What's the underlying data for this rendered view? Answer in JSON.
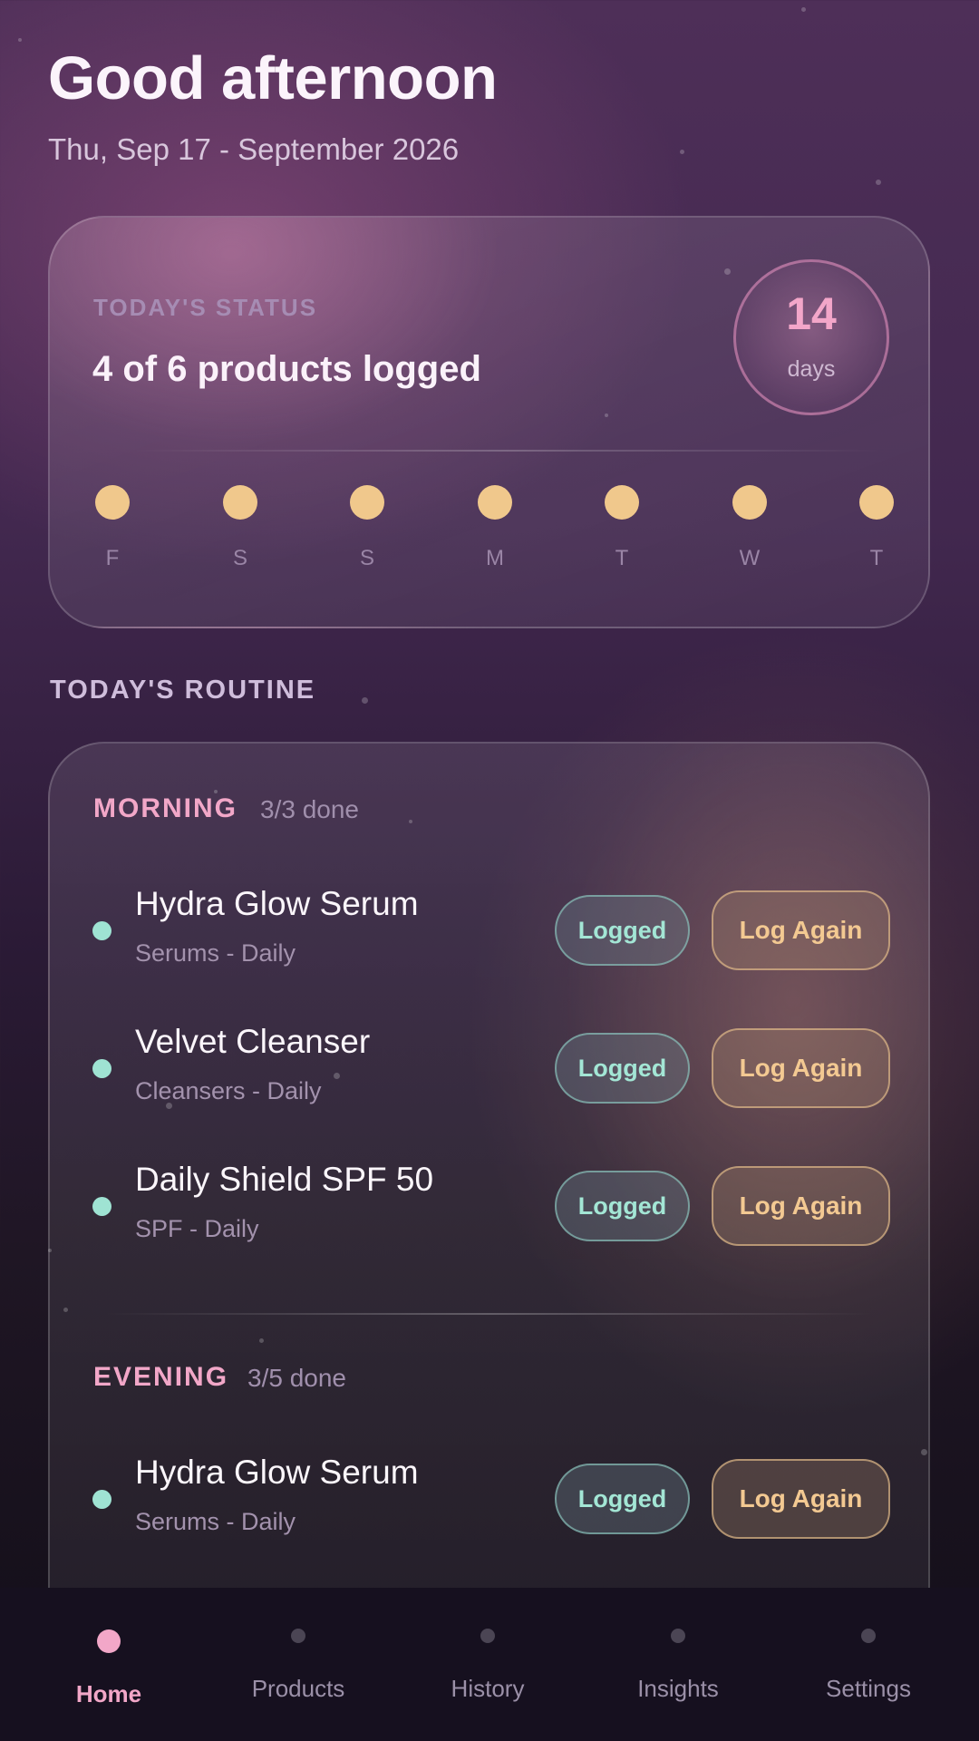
{
  "header": {
    "greeting": "Good afternoon",
    "date": "Thu, Sep 17 - September 2026"
  },
  "status": {
    "label": "TODAY'S STATUS",
    "summary": "4 of 6 products logged",
    "streak_number": "14",
    "streak_unit": "days",
    "week": [
      {
        "label": "F",
        "completed": true
      },
      {
        "label": "S",
        "completed": true
      },
      {
        "label": "S",
        "completed": true
      },
      {
        "label": "M",
        "completed": true
      },
      {
        "label": "T",
        "completed": true
      },
      {
        "label": "W",
        "completed": true
      },
      {
        "label": "T",
        "completed": true
      }
    ]
  },
  "routine": {
    "heading": "TODAY'S ROUTINE",
    "morning": {
      "title": "MORNING",
      "count": "3/3 done",
      "items": [
        {
          "name": "Hydra Glow Serum",
          "meta": "Serums - Daily",
          "logged_label": "Logged",
          "again_label": "Log Again"
        },
        {
          "name": "Velvet Cleanser",
          "meta": "Cleansers - Daily",
          "logged_label": "Logged",
          "again_label": "Log Again"
        },
        {
          "name": "Daily Shield SPF 50",
          "meta": "SPF - Daily",
          "logged_label": "Logged",
          "again_label": "Log Again"
        }
      ]
    },
    "evening": {
      "title": "EVENING",
      "count": "3/5 done",
      "items": [
        {
          "name": "Hydra Glow Serum",
          "meta": "Serums - Daily",
          "logged_label": "Logged",
          "again_label": "Log Again"
        }
      ]
    }
  },
  "nav": {
    "active": "Home",
    "tabs": [
      {
        "label": "Home",
        "icon": "home-dot-icon"
      },
      {
        "label": "Products",
        "icon": "products-dot-icon"
      },
      {
        "label": "History",
        "icon": "history-dot-icon"
      },
      {
        "label": "Insights",
        "icon": "insights-dot-icon"
      },
      {
        "label": "Settings",
        "icon": "settings-dot-icon"
      }
    ]
  },
  "colors": {
    "accent_pink": "#f2a7c8",
    "accent_mint": "#9fe3d3",
    "accent_gold": "#f0c88c"
  }
}
